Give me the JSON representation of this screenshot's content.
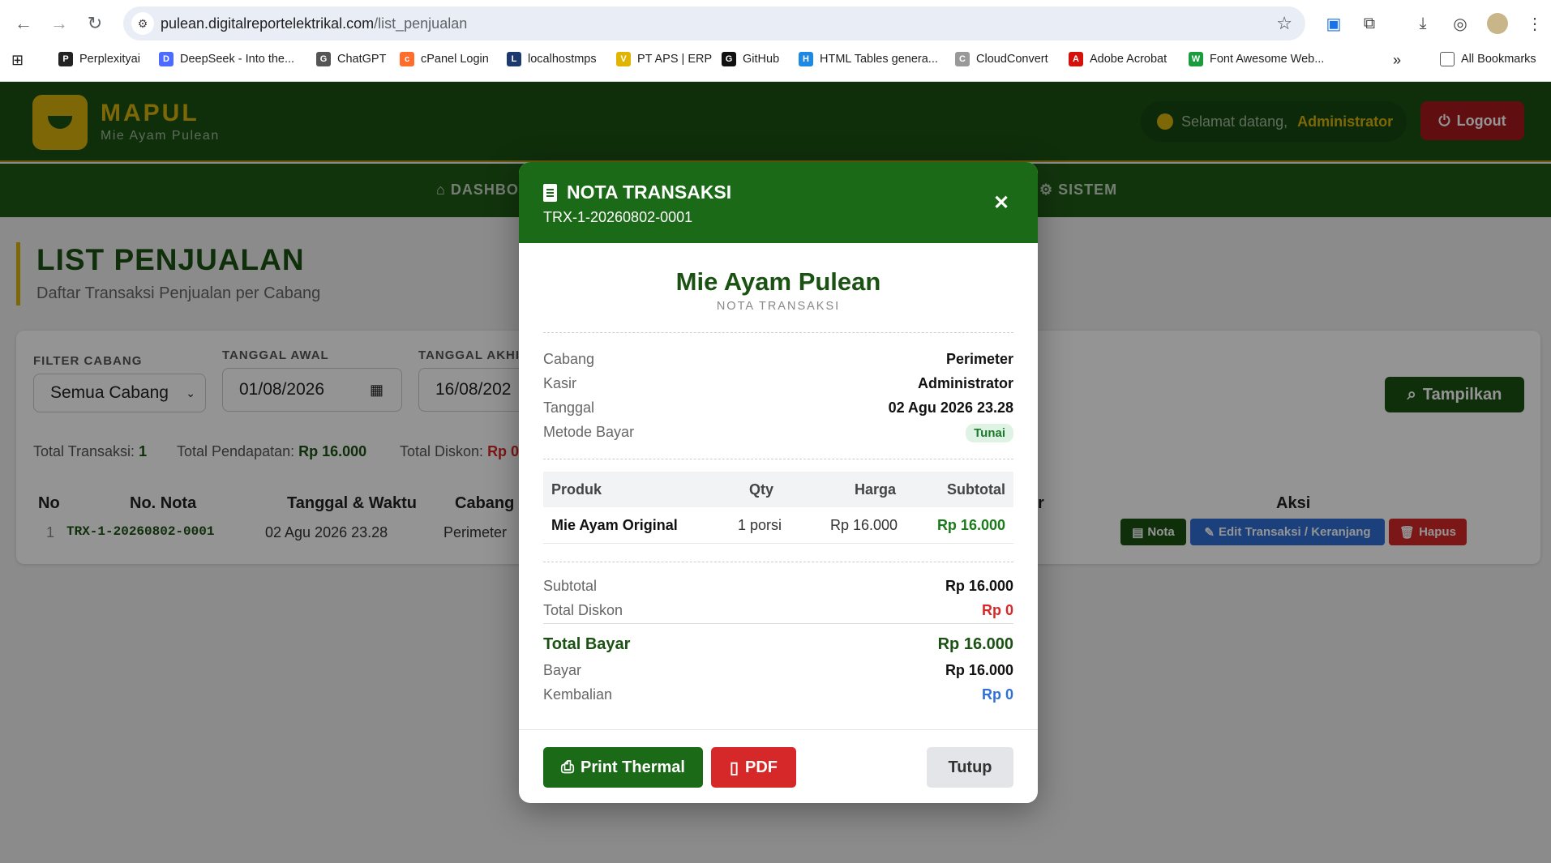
{
  "browser": {
    "url_host": "pulean.digitalreportelektrikal.com",
    "url_path": "/list_penjualan",
    "bookmarks": [
      "Perplexityai",
      "DeepSeek - Into the...",
      "ChatGPT",
      "cPanel Login",
      "localhostmps",
      "PT APS | ERP",
      "GitHub",
      "HTML Tables genera...",
      "CloudConvert",
      "Adobe Acrobat",
      "Font Awesome Web..."
    ],
    "all_bookmarks": "All Bookmarks",
    "more": "»"
  },
  "header": {
    "brand": "MAPUL",
    "brand_sub": "Mie Ayam Pulean",
    "welcome_prefix": "Selamat datang,",
    "welcome_user": "Administrator",
    "logout": "Logout",
    "nav_left": "DASHBO",
    "nav_right": "SISTEM"
  },
  "page": {
    "title": "LIST PENJUALAN",
    "subtitle": "Daftar Transaksi Penjualan per Cabang",
    "filter_cabang_label": "FILTER CABANG",
    "filter_cabang_value": "Semua Cabang",
    "tgl_awal_label": "TANGGAL AWAL",
    "tgl_awal_value": "01/08/2026",
    "tgl_akhir_label": "TANGGAL AKHI",
    "tgl_akhir_value": "16/08/202",
    "tampilkan": "Tampilkan",
    "stats": {
      "total_transaksi_label": "Total Transaksi:",
      "total_transaksi": "1",
      "total_pendapatan_label": "Total Pendapatan:",
      "total_pendapatan": "Rp 16.000",
      "total_diskon_label": "Total Diskon:",
      "total_diskon": "Rp 0"
    },
    "table": {
      "headers": [
        "No",
        "No. Nota",
        "Tanggal & Waktu",
        "Cabang",
        "r",
        "Aksi"
      ],
      "row": {
        "no": "1",
        "nota": "TRX-1-20260802-0001",
        "tanggal": "02 Agu 2026 23.28",
        "cabang": "Perimeter"
      },
      "actions": {
        "nota": "Nota",
        "edit": "Edit Transaksi / Keranjang",
        "hapus": "Hapus"
      }
    }
  },
  "modal": {
    "title": "NOTA TRANSAKSI",
    "nota_no": "TRX-1-20260802-0001",
    "shop_name": "Mie Ayam Pulean",
    "shop_sub": "NOTA TRANSAKSI",
    "info": [
      {
        "label": "Cabang",
        "value": "Perimeter"
      },
      {
        "label": "Kasir",
        "value": "Administrator"
      },
      {
        "label": "Tanggal",
        "value": "02 Agu 2026 23.28"
      },
      {
        "label": "Metode Bayar",
        "value": "Tunai"
      }
    ],
    "items_header": {
      "produk": "Produk",
      "qty": "Qty",
      "harga": "Harga",
      "subtotal": "Subtotal"
    },
    "items": [
      {
        "produk": "Mie Ayam Original",
        "qty": "1 porsi",
        "harga": "Rp 16.000",
        "subtotal": "Rp 16.000"
      }
    ],
    "totals": {
      "subtotal_label": "Subtotal",
      "subtotal": "Rp 16.000",
      "diskon_label": "Total Diskon",
      "diskon": "Rp 0",
      "total_label": "Total Bayar",
      "total": "Rp 16.000",
      "bayar_label": "Bayar",
      "bayar": "Rp 16.000",
      "kembalian_label": "Kembalian",
      "kembalian": "Rp 0"
    },
    "buttons": {
      "print": "Print Thermal",
      "pdf": "PDF",
      "tutup": "Tutup"
    }
  },
  "colors": {
    "brand_green": "#1b5214",
    "gold": "#d9b10c",
    "danger": "#d62828",
    "primary": "#2f6fd6"
  }
}
